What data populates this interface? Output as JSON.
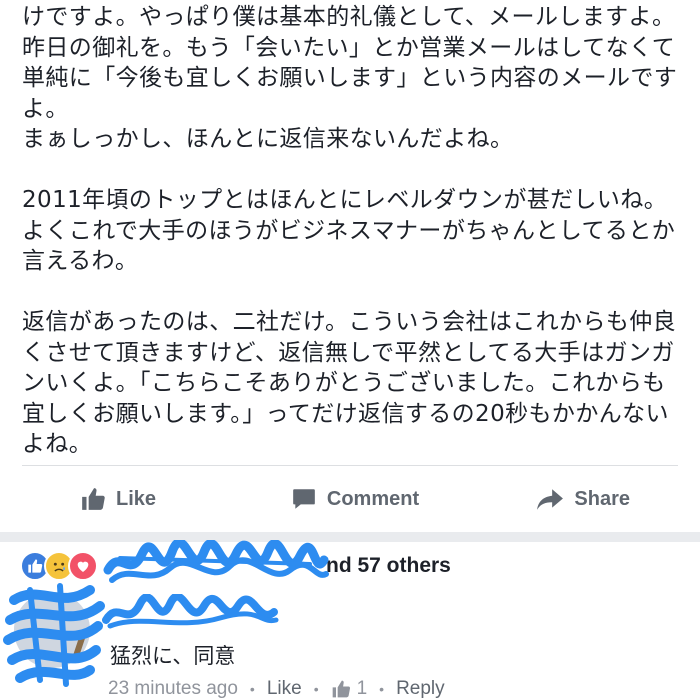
{
  "post": {
    "paragraphs": [
      [
        "けですよ。やっぱり僕は基本的礼儀として、メールしますよ。",
        "昨日の御礼を。もう「会いたい」とか営業メールはしてなくて",
        "単純に「今後も宜しくお願いします」という内容のメールです",
        "よ。",
        "まぁしっかし、ほんとに返信来ないんだよね。"
      ],
      [
        "2011年頃のトップとはほんとにレベルダウンが甚だしいね。",
        "よくこれで大手のほうがビジネスマナーがちゃんとしてるとか",
        "言えるわ。"
      ],
      [
        "返信があったのは、二社だけ。こういう会社はこれからも仲良",
        "くさせて頂きますけど、返信無しで平然としてる大手はガンガ",
        "ンいくよ。「こちらこそありがとうございました。これからも",
        "宜しくお願いします。」ってだけ返信するの20秒もかかんない",
        "よね。"
      ]
    ]
  },
  "actions": {
    "like_label": "Like",
    "comment_label": "Comment",
    "share_label": "Share",
    "like_icon": "thumbs-up-icon",
    "comment_icon": "speech-bubble-icon",
    "share_icon": "share-arrow-icon"
  },
  "reactions": {
    "icons": [
      "like-reaction-icon",
      "sad-reaction-icon",
      "love-reaction-icon"
    ],
    "names_text": "nd 57 others",
    "colors": {
      "like": "#3b7ddd",
      "sad": "#f5c33b",
      "love": "#f25268",
      "scribble": "#2d8cf0"
    }
  },
  "comment": {
    "author": "",
    "text": "猛烈に、同意",
    "time": "23 minutes ago",
    "like_label": "Like",
    "like_count": "1",
    "reply_label": "Reply"
  },
  "theme": {
    "text": "#1d2129",
    "muted": "#606770",
    "meta": "#90949c",
    "divider": "#dddfe2",
    "band": "#e9ebee"
  }
}
